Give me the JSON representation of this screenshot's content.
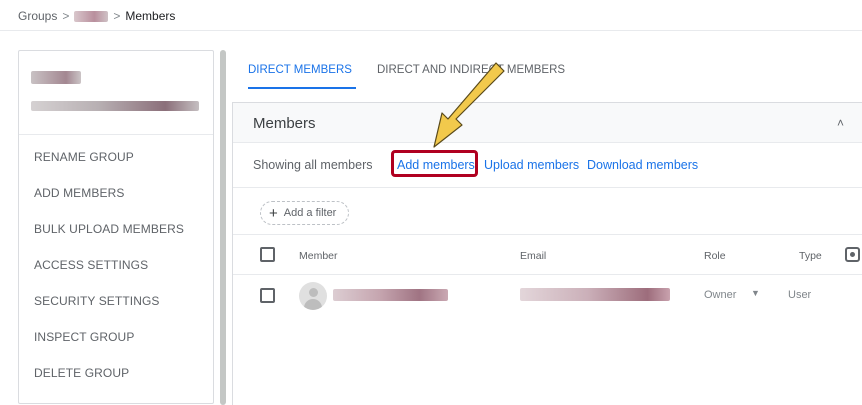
{
  "breadcrumb": {
    "root": "Groups",
    "separator": ">",
    "current": "Members"
  },
  "sidebar": {
    "items": [
      {
        "label": "RENAME GROUP"
      },
      {
        "label": "ADD MEMBERS"
      },
      {
        "label": "BULK UPLOAD MEMBERS"
      },
      {
        "label": "ACCESS SETTINGS"
      },
      {
        "label": "SECURITY SETTINGS"
      },
      {
        "label": "INSPECT GROUP"
      },
      {
        "label": "DELETE GROUP"
      }
    ]
  },
  "tabs": [
    {
      "label": "DIRECT MEMBERS",
      "active": true
    },
    {
      "label": "DIRECT AND INDIRECT MEMBERS",
      "active": false
    }
  ],
  "members_card": {
    "title": "Members",
    "collapse_icon": "chevron-up-icon",
    "showing_text": "Showing all members",
    "add_members": "Add members",
    "upload_members": "Upload members",
    "download_members": "Download members",
    "filter_label": "Add a filter"
  },
  "table": {
    "columns": {
      "member": "Member",
      "email": "Email",
      "role": "Role",
      "type": "Type"
    },
    "rows": [
      {
        "role": "Owner",
        "type": "User"
      }
    ]
  },
  "colors": {
    "accent": "#1a73e8",
    "highlight_box": "#b00020",
    "arrow": "#f2c94c"
  }
}
